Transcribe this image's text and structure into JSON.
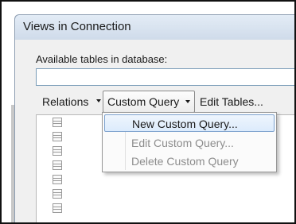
{
  "window": {
    "title": "Views in Connection"
  },
  "tables_section": {
    "label": "Available tables in database:",
    "field_value": ""
  },
  "toolbar": {
    "relations_label": "Relations",
    "custom_query_label": "Custom Query",
    "edit_tables_label": "Edit Tables..."
  },
  "menu": {
    "items": [
      {
        "label": "New Custom Query...",
        "state": "highlighted"
      },
      {
        "label": "Edit Custom Query...",
        "state": "disabled"
      },
      {
        "label": "Delete Custom Query",
        "state": "disabled"
      }
    ]
  },
  "table_list": {
    "icon": "table-icon",
    "row_count": 6
  }
}
